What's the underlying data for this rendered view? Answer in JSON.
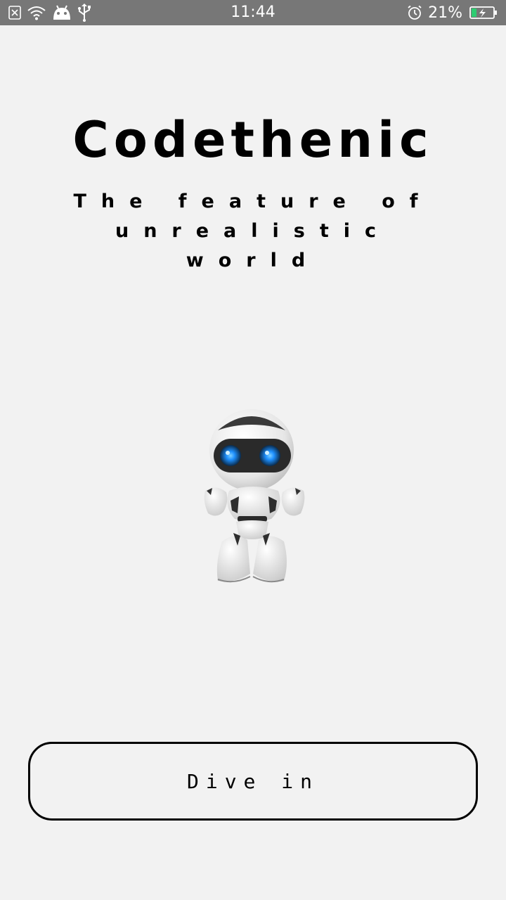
{
  "status_bar": {
    "time": "11:44",
    "battery_percent": "21%",
    "icons": [
      "no-sim-icon",
      "wifi-icon",
      "android-icon",
      "usb-icon",
      "alarm-icon",
      "battery-charging-icon"
    ]
  },
  "app": {
    "title": "Codethenic",
    "subtitle_line1": "The feature of",
    "subtitle_line2": "unrealistic world",
    "button_label": "Dive in",
    "illustration": "robot-illustration"
  },
  "colors": {
    "background": "#f2f2f2",
    "status_bar": "#777777",
    "text": "#000000",
    "battery_fill": "#2ecc71",
    "robot_eye": "#1e90ff"
  }
}
